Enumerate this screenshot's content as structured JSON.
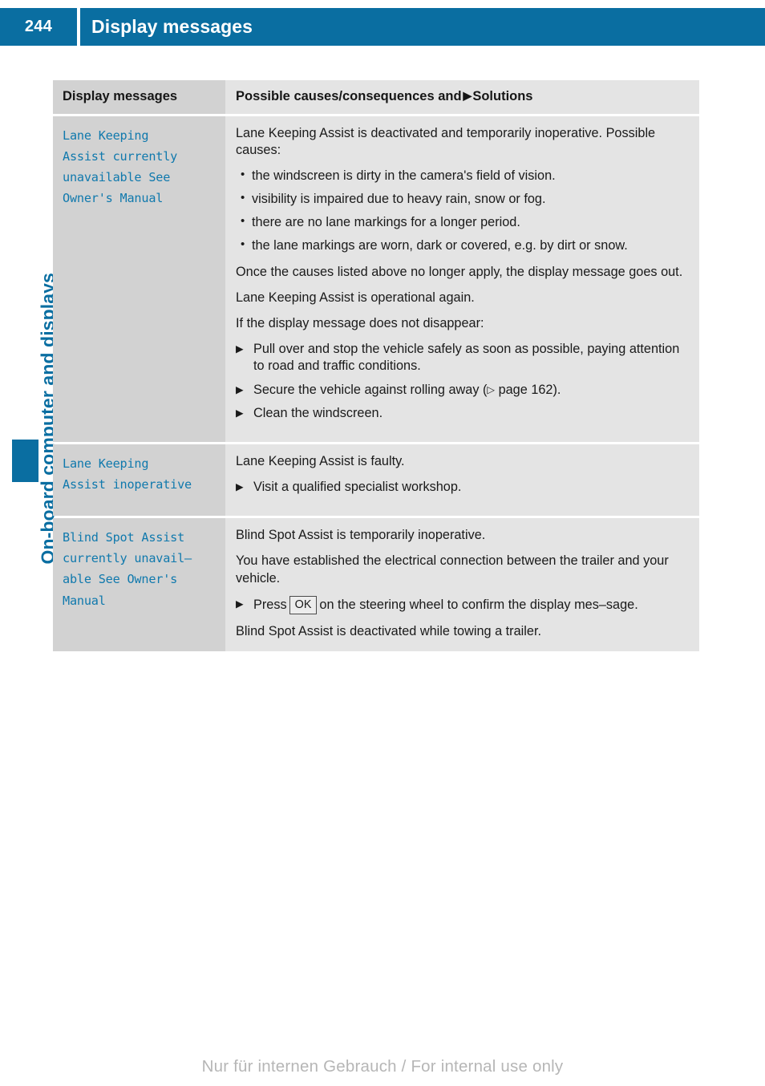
{
  "header": {
    "page_number": "244",
    "title": "Display messages"
  },
  "sidebar": {
    "chapter_label": "On-board computer and displays"
  },
  "table": {
    "columns": {
      "left": "Display messages",
      "right_prefix": "Possible causes/consequences and",
      "right_triangle": "▶",
      "right_suffix": "Solutions"
    },
    "rows": [
      {
        "message": "Lane Keeping\nAssist currently\nunavailable See\nOwner's Manual",
        "intro": "Lane Keeping Assist is deactivated and temporarily inoperative. Possible causes:",
        "bullets": [
          "the windscreen is dirty in the camera's field of vision.",
          "visibility is impaired due to heavy rain, snow or fog.",
          "there are no lane markings for a longer period.",
          "the lane markings are worn, dark or covered, e.g. by dirt or snow."
        ],
        "para_2": "Once the causes listed above no longer apply, the display message goes out.",
        "para_3": "Lane Keeping Assist is operational again.",
        "para_4": "If the display message does not disappear:",
        "step_1": "Pull over and stop the vehicle safely as soon as possible, paying attention to road and traffic conditions.",
        "step_2_pre": "Secure the vehicle against rolling away (",
        "step_2_tri": "▷",
        "step_2_post": " page 162).",
        "step_3": "Clean the windscreen."
      },
      {
        "message": "Lane Keeping\nAssist inoperative",
        "intro": "Lane Keeping Assist is faulty.",
        "step_1": "Visit a qualified specialist workshop."
      },
      {
        "message": "Blind Spot Assist\ncurrently unavail–\nable See Owner's\nManual",
        "intro": "Blind Spot Assist is temporarily inoperative.",
        "para_2": "You have established the electrical connection between the trailer and your vehicle.",
        "step_1_pre": "Press",
        "step_1_key": "OK",
        "step_1_post": "on the steering wheel to confirm the display mes–sage.",
        "para_3": "Blind Spot Assist is deactivated while towing a trailer."
      }
    ]
  },
  "footer": {
    "watermark": "Nur für internen Gebrauch / For internal use only"
  },
  "colors": {
    "brand_blue": "#0a6ea1",
    "message_blue": "#1079ad",
    "cell_left_bg": "#d2d2d2",
    "cell_right_bg": "#e4e4e4"
  }
}
